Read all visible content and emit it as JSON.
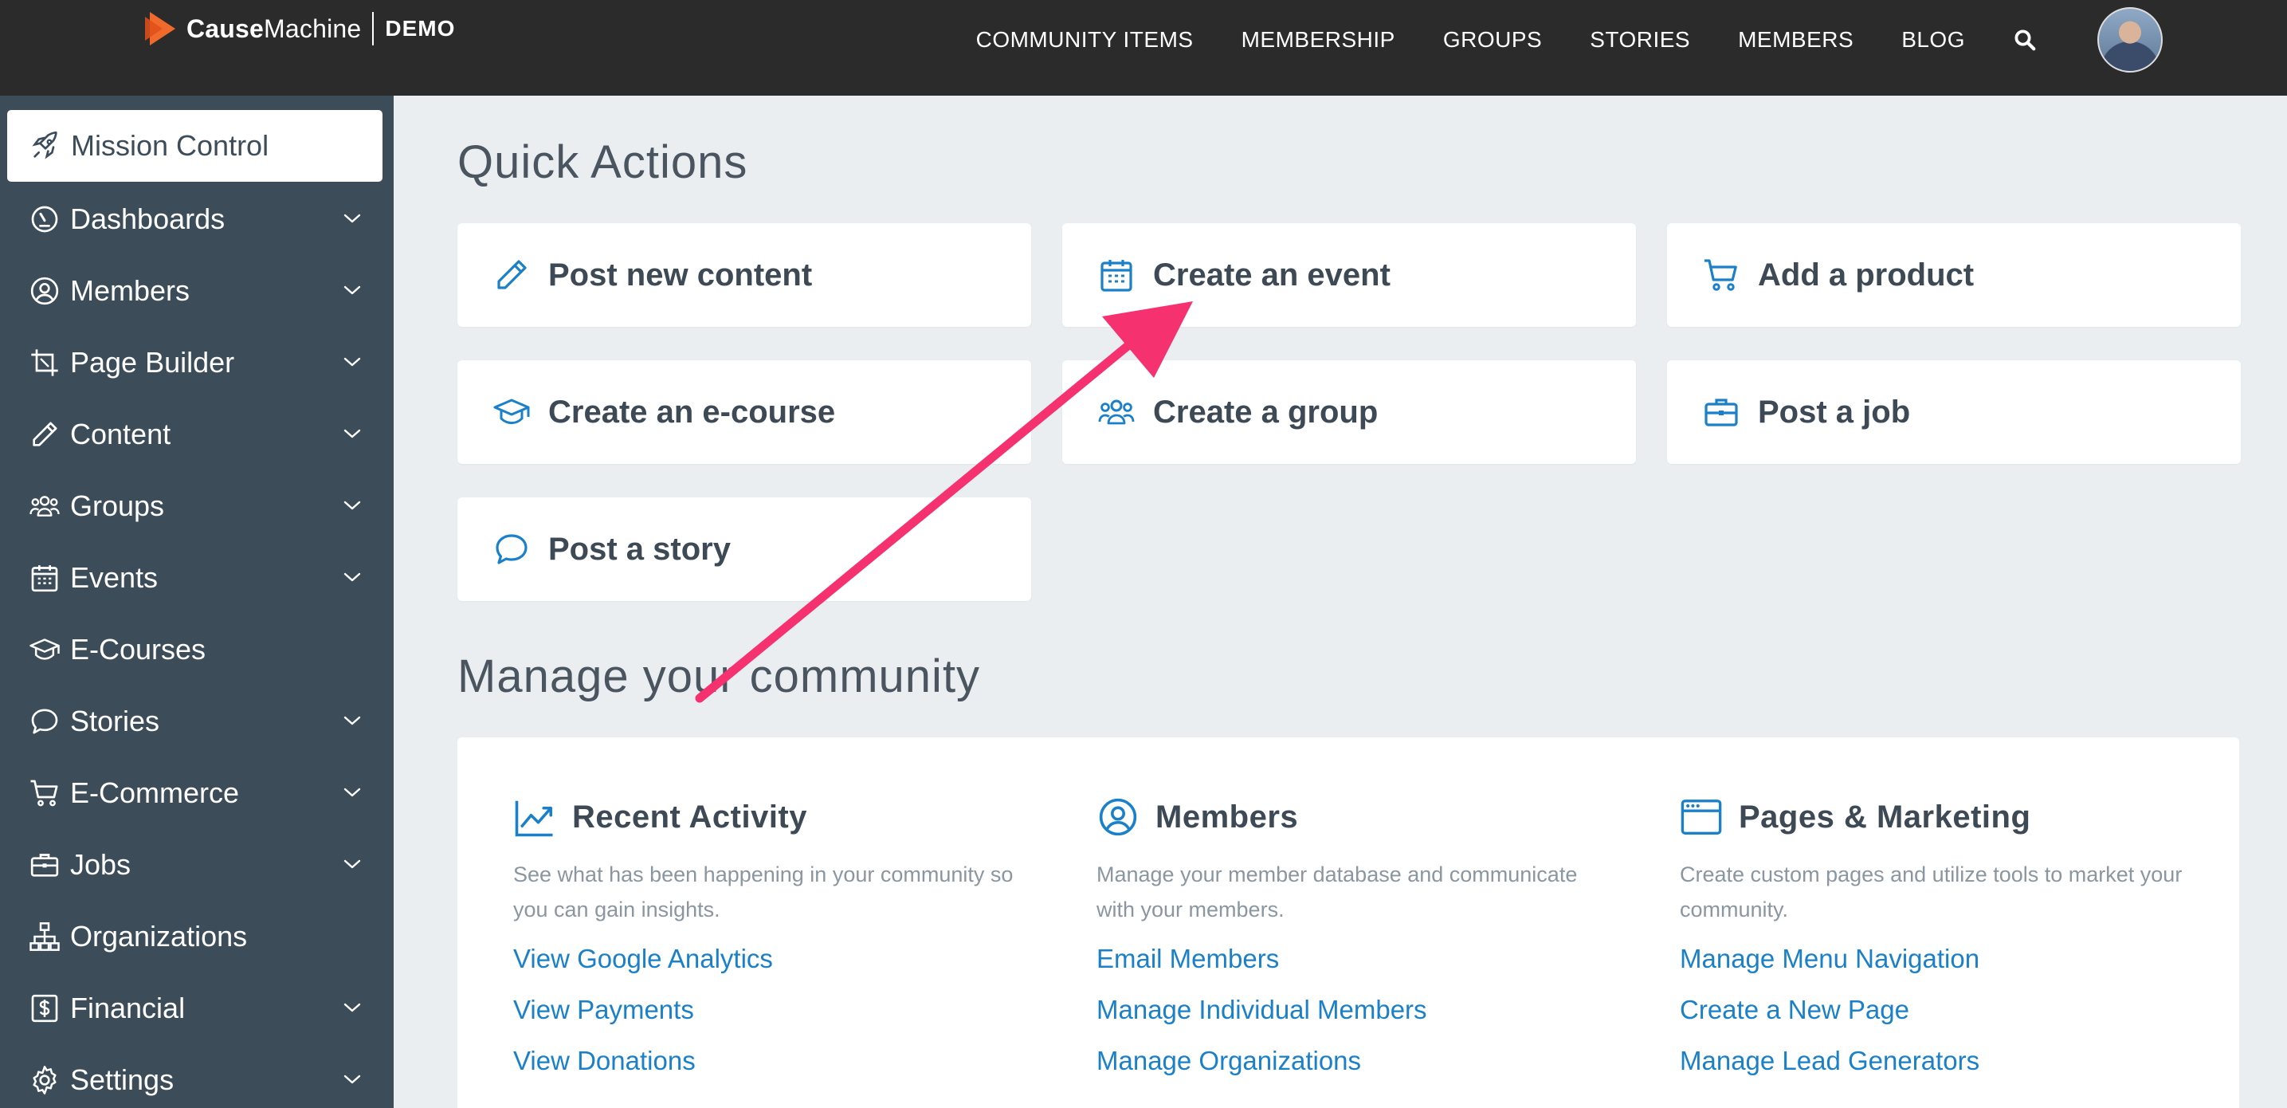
{
  "brand": {
    "name_bold": "Cause",
    "name_rest": "Machine",
    "demo": "DEMO"
  },
  "topnav": {
    "items": [
      "COMMUNITY ITEMS",
      "MEMBERSHIP",
      "GROUPS",
      "STORIES",
      "MEMBERS",
      "BLOG"
    ]
  },
  "sidebar": {
    "items": [
      {
        "label": "Mission Control",
        "icon": "rocket-icon",
        "chevron": false,
        "active": true
      },
      {
        "label": "Dashboards",
        "icon": "gauge-icon",
        "chevron": true
      },
      {
        "label": "Members",
        "icon": "user-circle-icon",
        "chevron": true
      },
      {
        "label": "Page Builder",
        "icon": "crop-icon",
        "chevron": true
      },
      {
        "label": "Content",
        "icon": "pencil-icon",
        "chevron": true
      },
      {
        "label": "Groups",
        "icon": "users-icon",
        "chevron": true
      },
      {
        "label": "Events",
        "icon": "calendar-icon",
        "chevron": true
      },
      {
        "label": "E-Courses",
        "icon": "graduation-cap-icon",
        "chevron": false
      },
      {
        "label": "Stories",
        "icon": "speech-bubble-icon",
        "chevron": true
      },
      {
        "label": "E-Commerce",
        "icon": "cart-icon",
        "chevron": true
      },
      {
        "label": "Jobs",
        "icon": "briefcase-icon",
        "chevron": true
      },
      {
        "label": "Organizations",
        "icon": "org-chart-icon",
        "chevron": false
      },
      {
        "label": "Financial",
        "icon": "dollar-icon",
        "chevron": true
      },
      {
        "label": "Settings",
        "icon": "gear-icon",
        "chevron": true
      }
    ]
  },
  "quick_actions": {
    "title": "Quick Actions",
    "items": [
      {
        "label": "Post new content",
        "icon": "pencil-icon"
      },
      {
        "label": "Create an event",
        "icon": "calendar-icon"
      },
      {
        "label": "Add a product",
        "icon": "cart-icon"
      },
      {
        "label": "Create an e-course",
        "icon": "graduation-cap-icon"
      },
      {
        "label": "Create a group",
        "icon": "users-icon"
      },
      {
        "label": "Post a job",
        "icon": "briefcase-icon"
      },
      {
        "label": "Post a story",
        "icon": "speech-bubble-icon"
      }
    ]
  },
  "manage": {
    "title": "Manage your community",
    "columns": [
      {
        "title": "Recent Activity",
        "icon": "chart-line-icon",
        "desc": "See what has been happening in your community so you can gain insights.",
        "links": [
          "View Google Analytics",
          "View Payments",
          "View Donations"
        ]
      },
      {
        "title": "Members",
        "icon": "user-circle-icon",
        "desc": "Manage your member database and communicate with your members.",
        "links": [
          "Email Members",
          "Manage Individual Members",
          "Manage Organizations"
        ]
      },
      {
        "title": "Pages & Marketing",
        "icon": "browser-window-icon",
        "desc": "Create custom pages and utilize tools to market your community.",
        "links": [
          "Manage Menu Navigation",
          "Create a New Page",
          "Manage Lead Generators"
        ]
      }
    ]
  },
  "colors": {
    "accent": "#1a80c9",
    "arrow": "#f5326f",
    "sidebar": "#3c4c59",
    "topbar": "#2b2b2b",
    "logo": "#f26a2b"
  }
}
